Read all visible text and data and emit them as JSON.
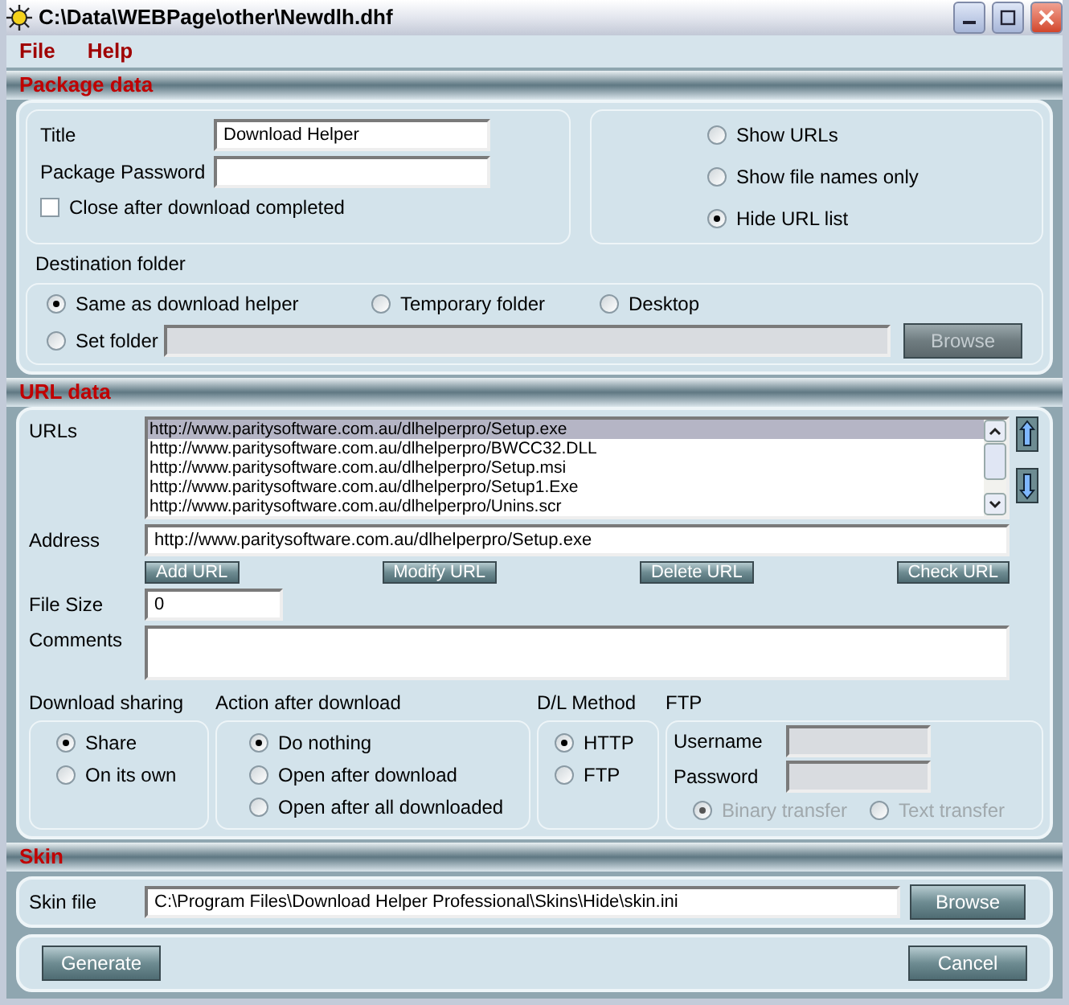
{
  "window": {
    "title": "C:\\Data\\WEBPage\\other\\Newdlh.dhf"
  },
  "menu": [
    {
      "label": "File"
    },
    {
      "label": "Help"
    }
  ],
  "package_data": {
    "heading": "Package data",
    "title_field": {
      "label": "Title",
      "value": "Download Helper"
    },
    "password_field": {
      "label": "Package Password"
    },
    "close_after": {
      "label": "Close after download completed",
      "checked": false
    },
    "url_display": [
      {
        "label": "Show URLs",
        "selected": false
      },
      {
        "label": "Show file names only",
        "selected": false
      },
      {
        "label": "Hide URL list",
        "selected": true
      }
    ],
    "destination": {
      "label": "Destination folder",
      "options": [
        {
          "label": "Same as download helper",
          "selected": true
        },
        {
          "label": "Temporary folder",
          "selected": false
        },
        {
          "label": "Desktop",
          "selected": false
        },
        {
          "label": "Set folder",
          "selected": false
        }
      ],
      "browse": {
        "label": "Browse",
        "disabled": true
      }
    }
  },
  "url_data": {
    "heading": "URL data",
    "urls_label": "URLs",
    "urls": [
      {
        "text": "http://www.paritysoftware.com.au/dlhelperpro/Setup.exe",
        "selected": true
      },
      {
        "text": "http://www.paritysoftware.com.au/dlhelperpro/BWCC32.DLL",
        "selected": false
      },
      {
        "text": "http://www.paritysoftware.com.au/dlhelperpro/Setup.msi",
        "selected": false
      },
      {
        "text": "http://www.paritysoftware.com.au/dlhelperpro/Setup1.Exe",
        "selected": false
      },
      {
        "text": "http://www.paritysoftware.com.au/dlhelperpro/Unins.scr",
        "selected": false
      }
    ],
    "address_label": "Address",
    "address": "http://www.paritysoftware.com.au/dlhelperpro/Setup.exe",
    "buttons": [
      "Add URL",
      "Modify URL",
      "Delete URL",
      "Check URL"
    ],
    "file_size_label": "File Size",
    "file_size": "0",
    "comments_label": "Comments",
    "download_sharing": {
      "label": "Download sharing",
      "options": [
        {
          "label": "Share",
          "selected": true
        },
        {
          "label": "On its own",
          "selected": false
        }
      ]
    },
    "action_after": {
      "label": "Action after download",
      "options": [
        {
          "label": "Do nothing",
          "selected": true
        },
        {
          "label": "Open after download",
          "selected": false
        },
        {
          "label": "Open after all downloaded",
          "selected": false
        }
      ]
    },
    "method": {
      "label": "D/L Method",
      "options": [
        {
          "label": "HTTP",
          "selected": true
        },
        {
          "label": "FTP",
          "selected": false
        }
      ]
    },
    "ftp": {
      "label": "FTP",
      "username_label": "Username",
      "password_label": "Password",
      "disabled": true,
      "transfer": [
        {
          "label": "Binary transfer",
          "selected": true
        },
        {
          "label": "Text transfer",
          "selected": false
        }
      ]
    }
  },
  "skin": {
    "heading": "Skin",
    "label": "Skin file",
    "value": "C:\\Program Files\\Download Helper Professional\\Skins\\Hide\\skin.ini",
    "browse": "Browse"
  },
  "actions": [
    "Generate",
    "Cancel"
  ]
}
